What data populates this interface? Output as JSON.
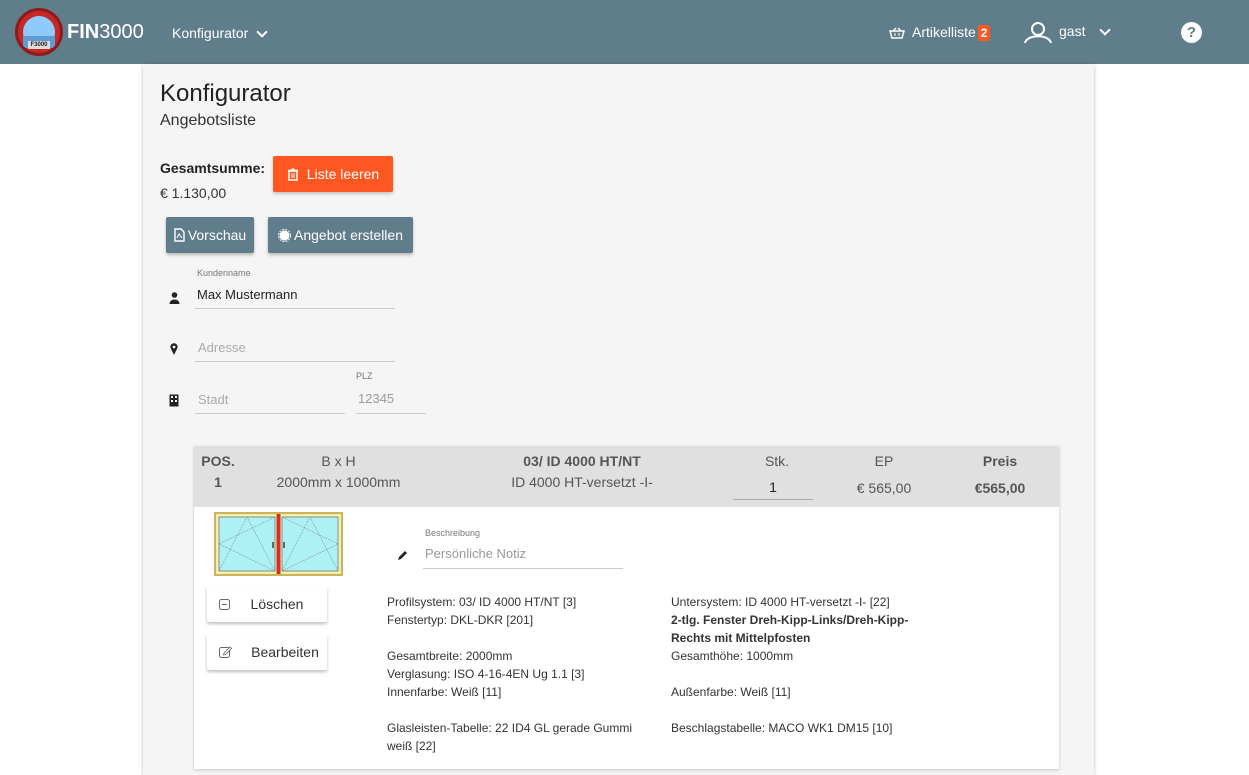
{
  "navbar": {
    "brand_bold": "FIN",
    "brand_rest": "3000",
    "logo_badge": "F3000",
    "menu_label": "Konfigurator",
    "cart_label": "Artikelliste",
    "cart_count": "2",
    "user_name": "gast",
    "help_label": "?"
  },
  "page": {
    "title": "Konfigurator",
    "subtitle": "Angebotsliste",
    "sum_label": "Gesamtsumme:",
    "sum_value": "€ 1.130,00",
    "clear_button": "Liste leeren",
    "preview_button": "Vorschau",
    "offer_button": "Angebot erstellen"
  },
  "form": {
    "customer_label": "Kundenname",
    "customer_value": "Max Mustermann",
    "address_placeholder": "Adresse",
    "city_placeholder": "Stadt",
    "zip_label": "PLZ",
    "zip_placeholder": "12345"
  },
  "table": {
    "headers": {
      "pos": "POS.",
      "size": "B x H",
      "system": "03/ ID 4000 HT/NT",
      "qty": "Stk.",
      "unit_price": "EP",
      "price": "Preis"
    },
    "row": {
      "pos": "1",
      "size": "2000mm x 1000mm",
      "system": "ID 4000 HT-versetzt -I-",
      "qty": "1",
      "unit_price": "€ 565,00",
      "price": "€565,00"
    }
  },
  "detail": {
    "delete_button": "Löschen",
    "edit_button": "Bearbeiten",
    "note_label": "Beschreibung",
    "note_placeholder": "Persönliche Notiz",
    "left_specs": {
      "profile": "Profilsystem: 03/ ID 4000 HT/NT [3]",
      "type": "Fenstertyp: DKL-DKR [201]",
      "width": "Gesamtbreite: 2000mm",
      "glazing": "Verglasung: ISO 4-16-4EN Ug 1.1 [3]",
      "inner_color": "Innenfarbe: Weiß [11]",
      "glass_bead_1": "Glasleisten-Tabelle: 22 ID4 GL gerade Gummi",
      "glass_bead_2": "weiß [22]"
    },
    "right_specs": {
      "subsystem": "Untersystem: ID 4000 HT-versetzt -I- [22]",
      "description_1": "2-tlg. Fenster Dreh-Kipp-Links/Dreh-Kipp-",
      "description_2": "Rechts mit Mittelpfosten",
      "height": "Gesamthöhe: 1000mm",
      "outer_color": "Außenfarbe: Weiß [11]",
      "hardware": "Beschlagstabelle: MACO WK1 DM15 [10]"
    }
  },
  "colors": {
    "navbar": "#607d8b",
    "accent": "#ff5722",
    "header_row": "#e0e0e0"
  }
}
